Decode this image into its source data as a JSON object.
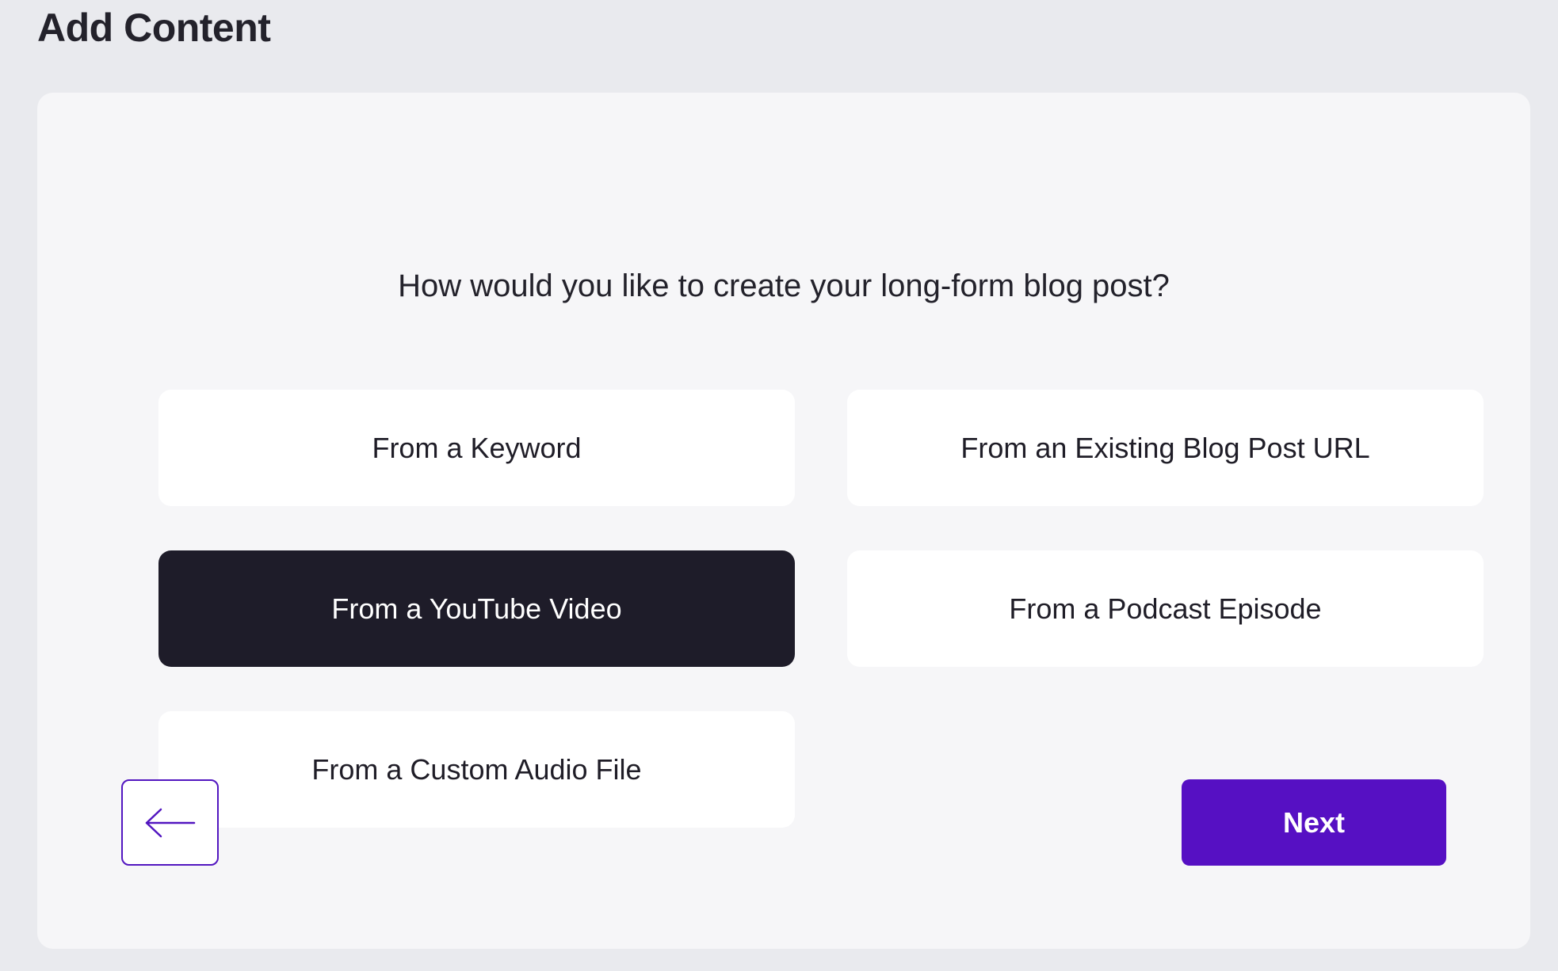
{
  "header": {
    "title": "Add Content"
  },
  "main": {
    "question": "How would you like to create your long-form blog post?",
    "options": [
      {
        "label": "From a Keyword",
        "selected": false
      },
      {
        "label": "From an Existing Blog Post URL",
        "selected": false
      },
      {
        "label": "From a YouTube Video",
        "selected": true
      },
      {
        "label": "From a Podcast Episode",
        "selected": false
      },
      {
        "label": "From a Custom Audio File",
        "selected": false
      }
    ],
    "back_icon": "arrow-left-icon",
    "next_label": "Next"
  },
  "colors": {
    "page_background": "#e9eaee",
    "card_background": "#f6f6f8",
    "selected_option": "#1e1c29",
    "accent": "#5610c3",
    "text": "#23222b"
  }
}
